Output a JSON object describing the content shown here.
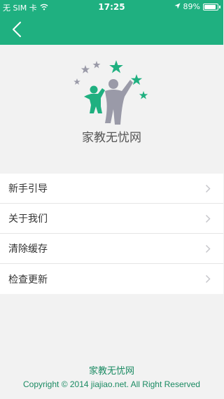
{
  "status_bar": {
    "carrier": "无 SIM 卡",
    "time": "17:25",
    "battery": "89%",
    "battery_level": 0.89
  },
  "header": {
    "back_icon": "chevron-left-icon",
    "color": "#1fb080"
  },
  "logo": {
    "app_name": "家教无忧网"
  },
  "menu": {
    "items": [
      {
        "label": "新手引导"
      },
      {
        "label": "关于我们"
      },
      {
        "label": "清除缓存"
      },
      {
        "label": "检查更新"
      }
    ]
  },
  "footer": {
    "name": "家教无忧网",
    "copyright": "Copyright © 2014 jiajiao.net. All Right Reserved"
  }
}
